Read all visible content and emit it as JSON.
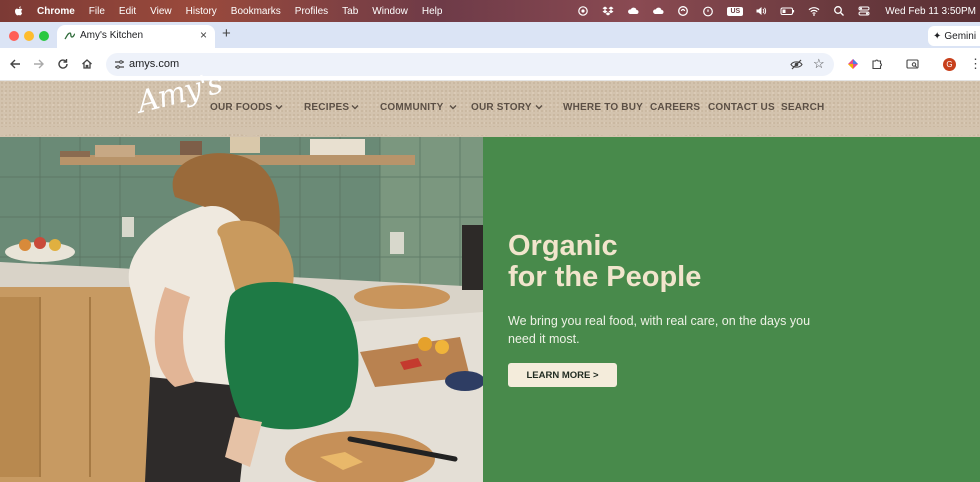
{
  "menubar": {
    "app": "Chrome",
    "items": [
      "File",
      "Edit",
      "View",
      "History",
      "Bookmarks",
      "Profiles",
      "Tab",
      "Window",
      "Help"
    ],
    "input_badge": "US",
    "clock": "Wed Feb 11  3:50PM"
  },
  "browser": {
    "tab_title": "Amy's Kitchen",
    "url": "amys.com",
    "gemini_label": "Gemini",
    "avatar_letter": "G"
  },
  "site": {
    "logo": "Amy's",
    "nav": [
      {
        "label": "OUR FOODS",
        "dropdown": true
      },
      {
        "label": "RECIPES",
        "dropdown": true
      },
      {
        "label": "COMMUNITY",
        "dropdown": true
      },
      {
        "label": "OUR STORY",
        "dropdown": true
      },
      {
        "label": "WHERE TO BUY",
        "dropdown": false
      },
      {
        "label": "CAREERS",
        "dropdown": false
      },
      {
        "label": "CONTACT US",
        "dropdown": false
      },
      {
        "label": "SEARCH",
        "dropdown": false
      }
    ]
  },
  "hero": {
    "headline_line1": "Organic",
    "headline_line2": "for the People",
    "subtext": "We bring you real food, with real care, on the days you need it most.",
    "cta": "LEARN MORE >"
  },
  "colors": {
    "hero_green": "#488a4b",
    "header_kraft": "#d3c3ae",
    "nav_text": "#5b4f45",
    "headline_cream": "#f1e5cc"
  }
}
